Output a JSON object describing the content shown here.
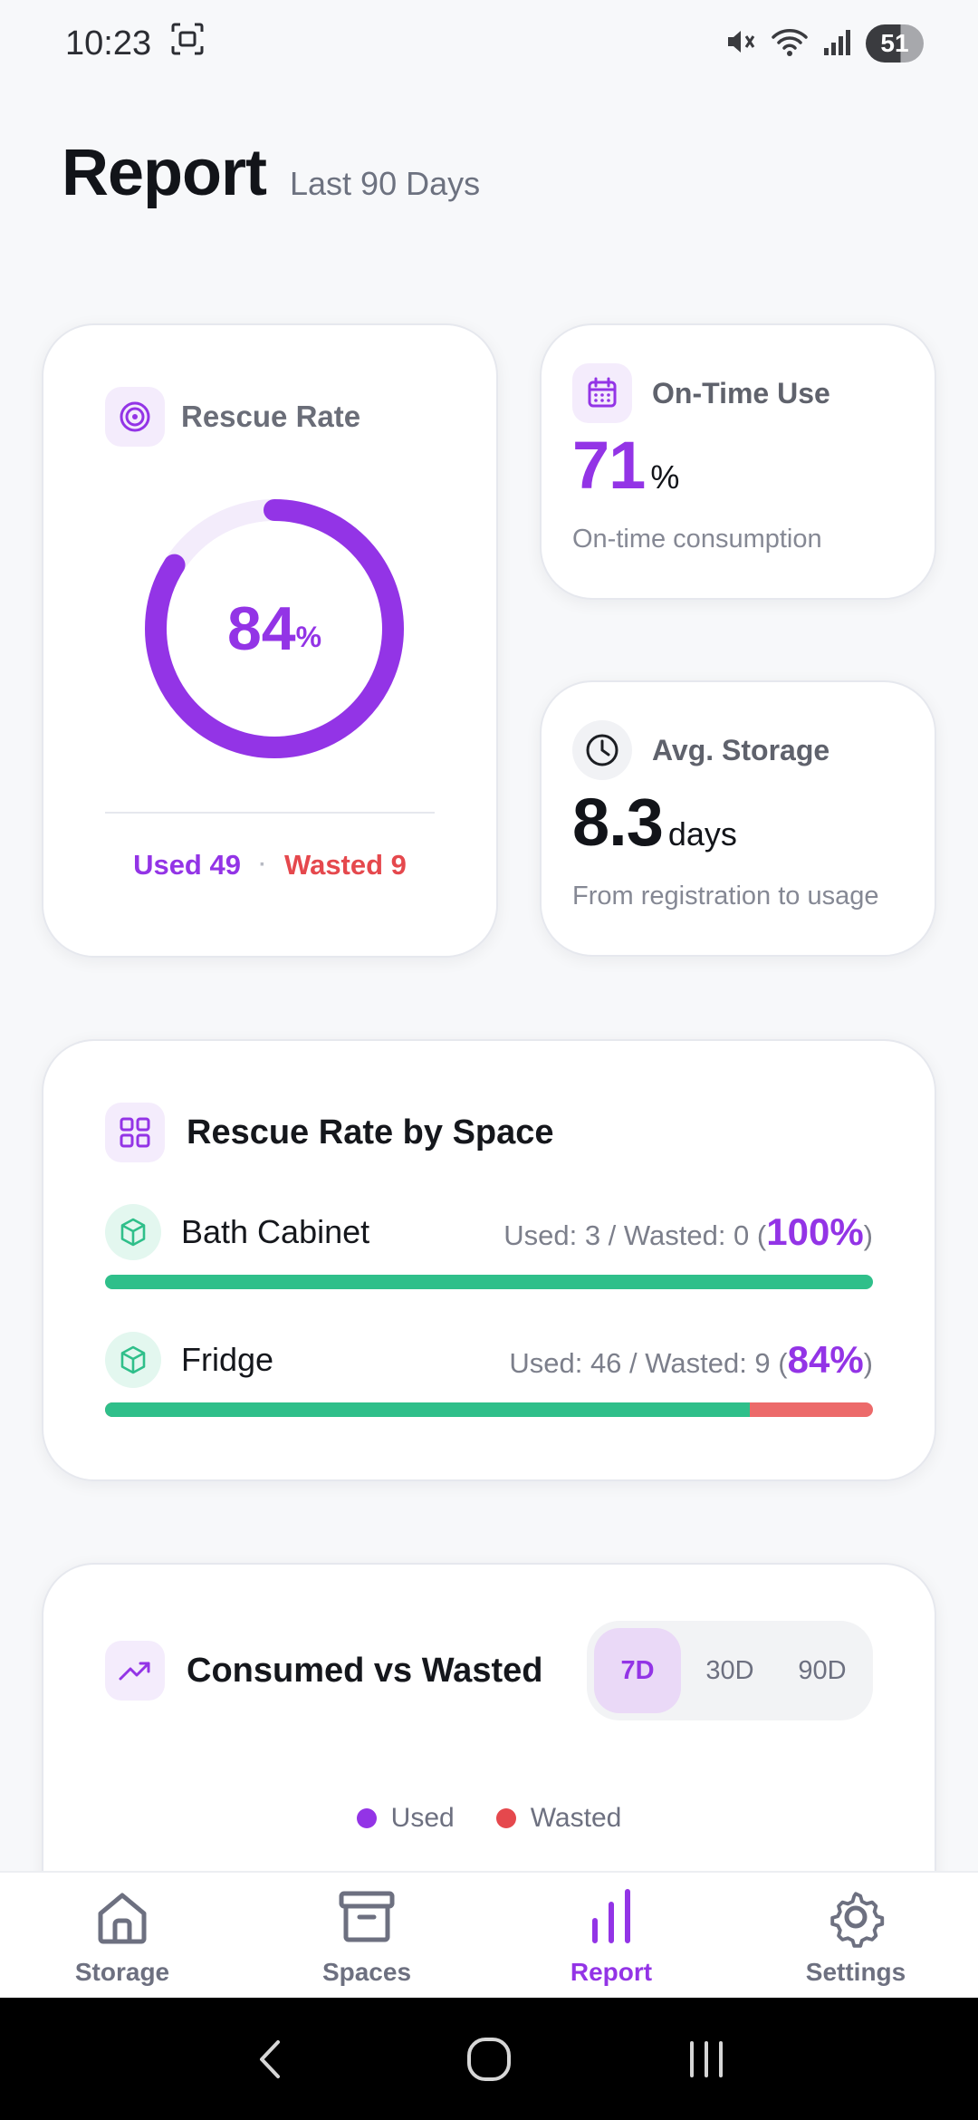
{
  "status_bar": {
    "time": "10:23",
    "battery": "51"
  },
  "header": {
    "title": "Report",
    "subtitle": "Last 90 Days"
  },
  "rescue_rate": {
    "title": "Rescue Rate",
    "value": "84",
    "unit": "%",
    "progress_fraction": 0.84,
    "used_label": "Used 49",
    "separator": "·",
    "wasted_label": "Wasted 9"
  },
  "on_time_use": {
    "title": "On-Time Use",
    "value": "71",
    "unit": "%",
    "caption": "On-time consumption"
  },
  "avg_storage": {
    "title": "Avg. Storage",
    "value": "8.3",
    "unit": "days",
    "caption": "From registration to usage"
  },
  "rescue_by_space": {
    "title": "Rescue Rate by Space",
    "items": [
      {
        "name": "Bath Cabinet",
        "stats": "Used: 3 / Wasted: 0 (",
        "pct": "100%",
        "close": ")",
        "rescue_fraction": 1.0
      },
      {
        "name": "Fridge",
        "stats": "Used: 46 / Wasted: 9 (",
        "pct": "84%",
        "close": ")",
        "rescue_fraction": 0.84
      }
    ]
  },
  "consumed_vs_wasted": {
    "title": "Consumed vs Wasted",
    "ranges": [
      "7D",
      "30D",
      "90D"
    ],
    "selected_range": "7D",
    "legend": {
      "used": "Used",
      "wasted": "Wasted"
    }
  },
  "bottom_nav": {
    "items": [
      {
        "label": "Storage",
        "icon": "home-icon"
      },
      {
        "label": "Spaces",
        "icon": "archive-icon"
      },
      {
        "label": "Report",
        "icon": "bar-chart-icon"
      },
      {
        "label": "Settings",
        "icon": "gear-icon"
      }
    ],
    "active": "Report"
  },
  "colors": {
    "accent": "#9334e6",
    "wasted": "#e5484d",
    "success": "#2fbf8a"
  }
}
